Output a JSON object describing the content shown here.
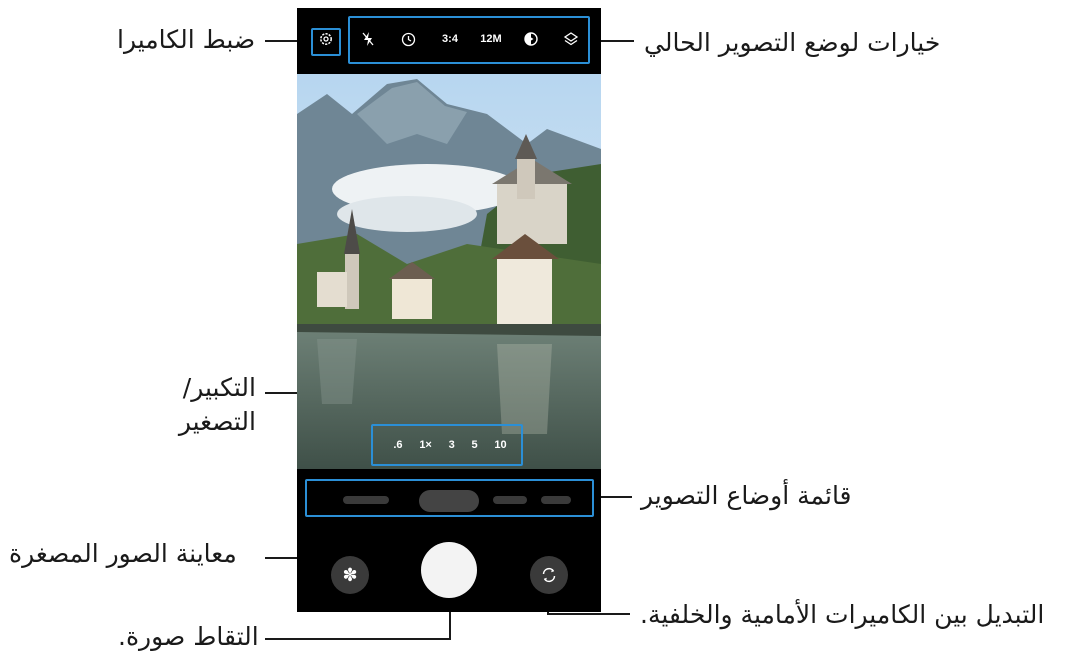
{
  "callouts": {
    "camera_settings": "ضبط الكاميرا",
    "current_mode_options": "خيارات لوضع التصوير الحالي",
    "zoom": "التكبير/\nالتصغير",
    "zoom_line1": "التكبير/",
    "zoom_line2": "التصغير",
    "modes_list": "قائمة أوضاع التصوير",
    "thumbnail_preview": "معاينة الصور المصغرة",
    "switch_cameras": "التبديل بين الكاميرات الأمامية والخلفية.",
    "take_picture": "التقاط صورة."
  },
  "top_options": {
    "ratio": "3:4",
    "resolution": "12M"
  },
  "zoom_levels": [
    ".6",
    "1×",
    "3",
    "5",
    "10"
  ],
  "colors": {
    "highlight_box": "#2b8fd6",
    "text": "#1a1a1a",
    "phone_bg": "#000000",
    "shutter": "#f3f3f3"
  }
}
